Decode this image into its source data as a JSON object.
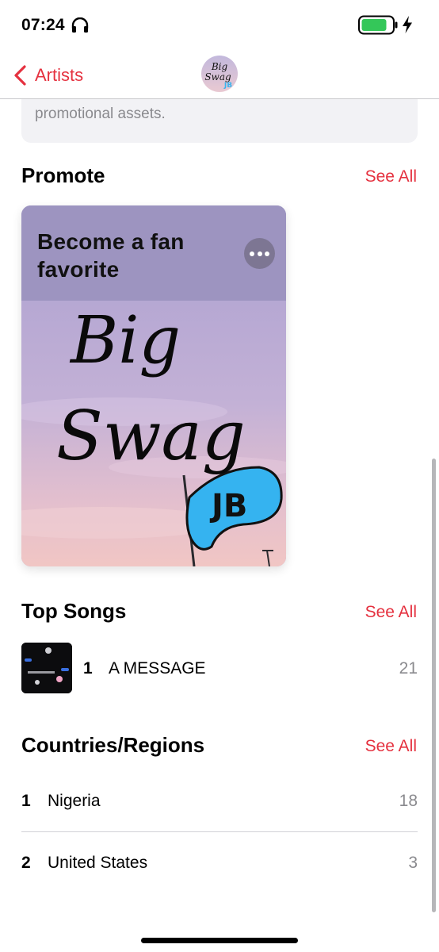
{
  "status_bar": {
    "time": "07:24",
    "headphones_icon": "headphones-icon",
    "battery_icon": "battery-icon",
    "charging_icon": "bolt-icon",
    "battery_color": "#34c759"
  },
  "nav": {
    "back_label": "Artists",
    "avatar_text_1": "Big",
    "avatar_text_2": "Swag",
    "avatar_text_3": "JB"
  },
  "info_card": {
    "text": "Tap a song, album, or video to create and share custom promotional assets."
  },
  "promote": {
    "title": "Promote",
    "see_all": "See All",
    "card_title": "Become a fan favorite",
    "art_line_1": "Big",
    "art_line_2": "Swag",
    "art_badge": "JB"
  },
  "top_songs": {
    "title": "Top Songs",
    "see_all": "See All",
    "items": [
      {
        "rank": "1",
        "name": "A MESSAGE",
        "count": "21"
      }
    ]
  },
  "countries": {
    "title": "Countries/Regions",
    "see_all": "See All",
    "items": [
      {
        "rank": "1",
        "name": "Nigeria",
        "count": "18"
      },
      {
        "rank": "2",
        "name": "United States",
        "count": "3"
      }
    ]
  },
  "colors": {
    "accent": "#e5313f",
    "secondary_text": "#8a8a8e",
    "card_bg": "#f2f2f5",
    "promo_band": "#9b92be"
  }
}
